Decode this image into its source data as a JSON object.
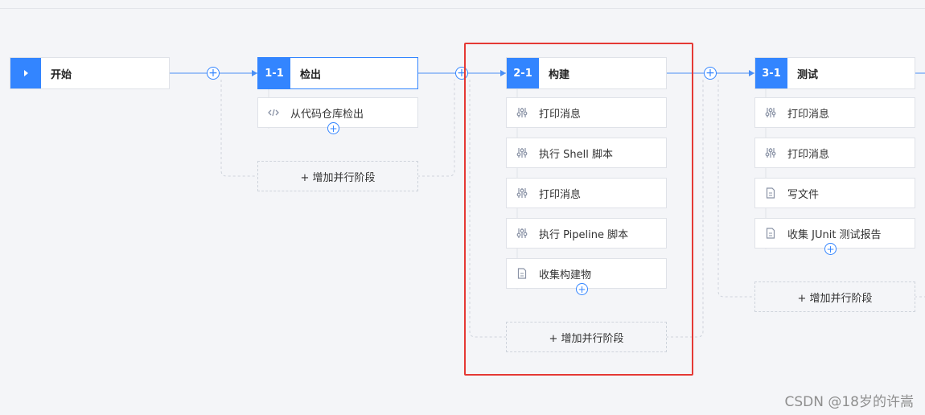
{
  "start": {
    "label": "开始"
  },
  "stages": [
    {
      "id": "1-1",
      "title": "检出",
      "tasks": [
        "从代码仓库检出"
      ],
      "add_parallel": "+ 增加并行阶段"
    },
    {
      "id": "2-1",
      "title": "构建",
      "tasks": [
        "打印消息",
        "执行 Shell 脚本",
        "打印消息",
        "执行 Pipeline 脚本",
        "收集构建物"
      ],
      "add_parallel": "+ 增加并行阶段"
    },
    {
      "id": "3-1",
      "title": "测试",
      "tasks": [
        "打印消息",
        "打印消息",
        "写文件",
        "收集 JUnit 测试报告"
      ],
      "add_parallel": "+ 增加并行阶段"
    }
  ],
  "icons": {
    "play": "play-icon",
    "code": "code-icon",
    "sliders": "sliders-icon",
    "file": "file-icon"
  },
  "colors": {
    "accent": "#3385ff",
    "highlight": "#e53935"
  },
  "watermark": "CSDN @18岁的许嵩"
}
